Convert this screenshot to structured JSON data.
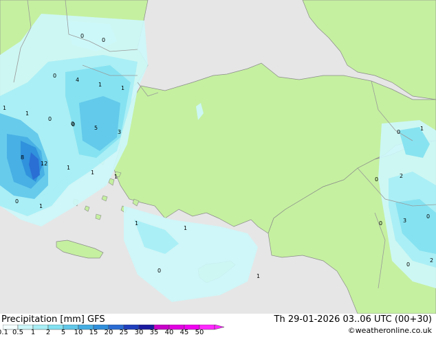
{
  "map": {
    "colors": {
      "sea": "#e6e6e6",
      "land": "#c5f0a0",
      "border": "#999999",
      "coast": "#8a8a8a"
    },
    "precip_labels": [
      {
        "value": "0"
      },
      {
        "value": "0"
      },
      {
        "value": "0"
      },
      {
        "value": "4"
      },
      {
        "value": "1"
      },
      {
        "value": "1"
      },
      {
        "value": "1"
      },
      {
        "value": "1"
      },
      {
        "value": "0"
      },
      {
        "value": "0"
      },
      {
        "value": "5"
      },
      {
        "value": "3"
      },
      {
        "value": "8"
      },
      {
        "value": "12"
      },
      {
        "value": "1"
      },
      {
        "value": "1"
      },
      {
        "value": "1"
      },
      {
        "value": "0"
      },
      {
        "value": "1"
      },
      {
        "value": "1"
      },
      {
        "value": "1"
      },
      {
        "value": "0"
      },
      {
        "value": "1"
      },
      {
        "value": "0"
      },
      {
        "value": "1"
      },
      {
        "value": "0"
      },
      {
        "value": "2"
      },
      {
        "value": "0"
      },
      {
        "value": "0"
      },
      {
        "value": "3"
      },
      {
        "value": "0"
      },
      {
        "value": "0"
      },
      {
        "value": "2"
      }
    ]
  },
  "footer": {
    "title": "Precipitation [mm]  GFS",
    "datetime": "Th 29-01-2026 03..06 UTC (00+30)",
    "credit": "©weatheronline.co.uk"
  },
  "legend": {
    "ticks": [
      "0.1",
      "0.5",
      "1",
      "2",
      "5",
      "10",
      "15",
      "20",
      "25",
      "30",
      "35",
      "40",
      "45",
      "50"
    ],
    "colors": [
      "#f5ffff",
      "#cdf7fa",
      "#a7eef5",
      "#82e1f0",
      "#62c8ea",
      "#45aee3",
      "#2f8edb",
      "#2a6cd3",
      "#1f3fbe",
      "#1a1aa0",
      "#c800c8",
      "#e100e1",
      "#f000f0",
      "#ff28ff"
    ]
  }
}
